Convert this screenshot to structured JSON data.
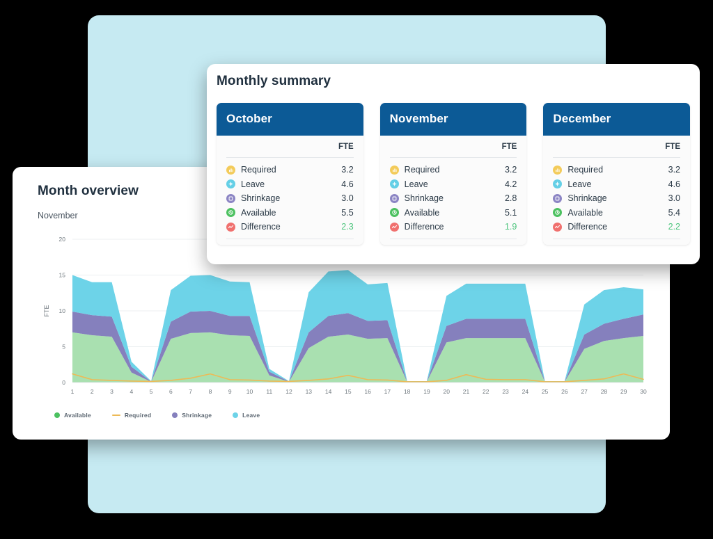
{
  "colors": {
    "backdrop": "#C6EAF2",
    "header_blue": "#0C5A96",
    "available": "#A9E0B0",
    "available_dot": "#4CC160",
    "required": "#EDBA56",
    "shrinkage": "#8580BD",
    "leave": "#6DD3E8",
    "difference_value": "#4CC47C",
    "required_icon": "#F3CB5A",
    "leave_icon": "#64CFE6",
    "shrinkage_icon": "#8C85C4",
    "available_icon": "#4CC160",
    "difference_icon": "#F0706E"
  },
  "overview": {
    "title": "Month overview",
    "subtitle": "November",
    "legend": [
      {
        "label": "Available",
        "marker": "dot",
        "color": "#4CC160",
        "icon": "legend-dot-available"
      },
      {
        "label": "Required",
        "marker": "line",
        "color": "#EDBA56",
        "icon": "legend-line-required"
      },
      {
        "label": "Shrinkage",
        "marker": "dot",
        "color": "#8580BD",
        "icon": "legend-dot-shrinkage"
      },
      {
        "label": "Leave",
        "marker": "dot",
        "color": "#6DD3E8",
        "icon": "legend-dot-leave"
      }
    ]
  },
  "chart_data": {
    "type": "area",
    "title": "Month overview",
    "subtitle": "November",
    "xlabel": "",
    "ylabel": "FTE",
    "ylim": [
      0,
      20
    ],
    "yticks": [
      0,
      5,
      10,
      15,
      20
    ],
    "grid": true,
    "legend_position": "bottom-left",
    "stacked": true,
    "x": [
      1,
      2,
      3,
      4,
      5,
      6,
      7,
      8,
      9,
      10,
      11,
      12,
      13,
      14,
      15,
      16,
      17,
      18,
      19,
      20,
      21,
      22,
      23,
      24,
      25,
      26,
      27,
      28,
      29,
      30
    ],
    "xticklabels": [
      "1",
      "2",
      "3",
      "4",
      "5",
      "6",
      "7",
      "8",
      "9",
      "10",
      "11",
      "12",
      "13",
      "14",
      "15",
      "16",
      "17",
      "18",
      "19",
      "20",
      "21",
      "22",
      "23",
      "24",
      "25",
      "26",
      "27",
      "28",
      "29",
      "30"
    ],
    "series": [
      {
        "name": "Available",
        "type": "area",
        "color": "#A9E0B0",
        "values": [
          7.0,
          6.6,
          6.4,
          1.4,
          0.1,
          6.1,
          6.9,
          7.0,
          6.6,
          6.5,
          1.0,
          0.1,
          4.8,
          6.4,
          6.7,
          6.1,
          6.2,
          0.1,
          0.1,
          5.6,
          6.2,
          6.2,
          6.2,
          6.2,
          0.1,
          0.1,
          4.7,
          5.8,
          6.2,
          6.5
        ]
      },
      {
        "name": "Shrinkage",
        "type": "area",
        "color": "#8580BD",
        "values": [
          2.9,
          2.8,
          2.8,
          0.8,
          0.05,
          2.4,
          3.0,
          3.0,
          2.7,
          2.8,
          0.5,
          0.05,
          2.2,
          2.9,
          3.0,
          2.5,
          2.5,
          0.05,
          0.05,
          2.3,
          2.7,
          2.7,
          2.7,
          2.7,
          0.05,
          0.05,
          2.0,
          2.4,
          2.7,
          3.0
        ]
      },
      {
        "name": "Leave",
        "type": "area",
        "color": "#6DD3E8",
        "values": [
          5.1,
          4.6,
          4.8,
          0.7,
          0.05,
          4.4,
          5.0,
          5.0,
          4.8,
          4.7,
          0.4,
          0.05,
          5.6,
          6.2,
          6.0,
          5.1,
          5.2,
          0.05,
          0.05,
          4.2,
          4.9,
          4.9,
          4.9,
          4.9,
          0.05,
          0.05,
          4.2,
          4.7,
          4.4,
          3.5
        ]
      },
      {
        "name": "Required",
        "type": "line",
        "color": "#EDBA56",
        "values": [
          1.2,
          0.4,
          0.3,
          0.2,
          0.15,
          0.3,
          0.6,
          1.2,
          0.4,
          0.35,
          0.2,
          0.15,
          0.3,
          0.5,
          1.0,
          0.4,
          0.35,
          0.1,
          0.1,
          0.3,
          1.1,
          0.45,
          0.4,
          0.4,
          0.1,
          0.1,
          0.3,
          0.5,
          1.2,
          0.45
        ]
      }
    ]
  },
  "summary": {
    "title": "Monthly summary",
    "fte_header": "FTE",
    "months": [
      {
        "name": "October",
        "rows": [
          {
            "icon": "required-icon",
            "label": "Required",
            "value": "3.2",
            "highlight": false
          },
          {
            "icon": "leave-icon",
            "label": "Leave",
            "value": "4.6",
            "highlight": false
          },
          {
            "icon": "shrinkage-icon",
            "label": "Shrinkage",
            "value": "3.0",
            "highlight": false
          },
          {
            "icon": "available-icon",
            "label": "Available",
            "value": "5.5",
            "highlight": false
          },
          {
            "icon": "difference-icon",
            "label": "Difference",
            "value": "2.3",
            "highlight": true
          }
        ]
      },
      {
        "name": "November",
        "rows": [
          {
            "icon": "required-icon",
            "label": "Required",
            "value": "3.2",
            "highlight": false
          },
          {
            "icon": "leave-icon",
            "label": "Leave",
            "value": "4.2",
            "highlight": false
          },
          {
            "icon": "shrinkage-icon",
            "label": "Shrinkage",
            "value": "2.8",
            "highlight": false
          },
          {
            "icon": "available-icon",
            "label": "Available",
            "value": "5.1",
            "highlight": false
          },
          {
            "icon": "difference-icon",
            "label": "Difference",
            "value": "1.9",
            "highlight": true
          }
        ]
      },
      {
        "name": "December",
        "rows": [
          {
            "icon": "required-icon",
            "label": "Required",
            "value": "3.2",
            "highlight": false
          },
          {
            "icon": "leave-icon",
            "label": "Leave",
            "value": "4.6",
            "highlight": false
          },
          {
            "icon": "shrinkage-icon",
            "label": "Shrinkage",
            "value": "3.0",
            "highlight": false
          },
          {
            "icon": "available-icon",
            "label": "Available",
            "value": "5.4",
            "highlight": false
          },
          {
            "icon": "difference-icon",
            "label": "Difference",
            "value": "2.2",
            "highlight": true
          }
        ]
      }
    ]
  }
}
